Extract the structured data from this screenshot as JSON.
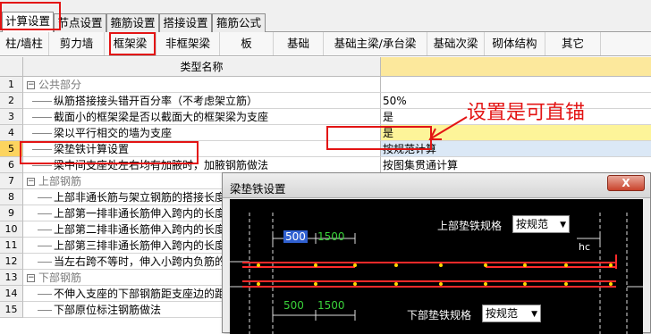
{
  "tabs": [
    "计算设置",
    "节点设置",
    "箍筋设置",
    "搭接设置",
    "箍筋公式"
  ],
  "subtabs": [
    "柱/墙柱",
    "剪力墙",
    "框架梁",
    "非框架梁",
    "板",
    "基础",
    "基础主梁/承台梁",
    "基础次梁",
    "砌体结构",
    "其它"
  ],
  "header": {
    "name": "类型名称"
  },
  "rows": [
    {
      "n": "1",
      "name": "公共部分",
      "value": ""
    },
    {
      "n": "2",
      "name": "纵筋搭接接头错开百分率（不考虑架立筋）",
      "value": "50%"
    },
    {
      "n": "3",
      "name": "截面小的框架梁是否以截面大的框架梁为支座",
      "value": "是"
    },
    {
      "n": "4",
      "name": "梁以平行相交的墙为支座",
      "value": "是"
    },
    {
      "n": "5",
      "name": "梁垫铁计算设置",
      "value": "按规范计算"
    },
    {
      "n": "6",
      "name": "梁中间支座处左右均有加腋时，加腋钢筋做法",
      "value": "按图集贯通计算"
    },
    {
      "n": "7",
      "name": "上部钢筋",
      "value": ""
    },
    {
      "n": "8",
      "name": "上部非通长筋与架立钢筋的搭接长度",
      "value": ""
    },
    {
      "n": "9",
      "name": "上部第一排非通长筋伸入跨内的长度",
      "value": ""
    },
    {
      "n": "10",
      "name": "上部第二排非通长筋伸入跨内的长度",
      "value": ""
    },
    {
      "n": "11",
      "name": "上部第三排非通长筋伸入跨内的长度",
      "value": ""
    },
    {
      "n": "12",
      "name": "当左右跨不等时，伸入小跨内负筋的",
      "value": ""
    },
    {
      "n": "13",
      "name": "下部钢筋",
      "value": ""
    },
    {
      "n": "14",
      "name": "不伸入支座的下部钢筋距支座边的距",
      "value": ""
    },
    {
      "n": "15",
      "name": "下部原位标注钢筋做法",
      "value": ""
    }
  ],
  "annotation": "设置是可直锚",
  "dialog": {
    "title": "梁垫铁设置",
    "close": "X",
    "top_label": "上部垫铁规格",
    "top_select": "按规范",
    "bottom_label": "下部垫铁规格",
    "bottom_select": "按规范",
    "dim_top_a": "500",
    "dim_top_b": "1500",
    "dim_bottom_a": "500",
    "dim_bottom_b": "1500",
    "hc": "hc"
  },
  "colors": {
    "highlight_red": "#e31414",
    "selected_row": "#fcd45f",
    "yellow_cell": "#fdf499",
    "rebar_red": "#ff2a2a",
    "dim_green": "#3ad23a",
    "gold_dot": "#ffd700"
  }
}
